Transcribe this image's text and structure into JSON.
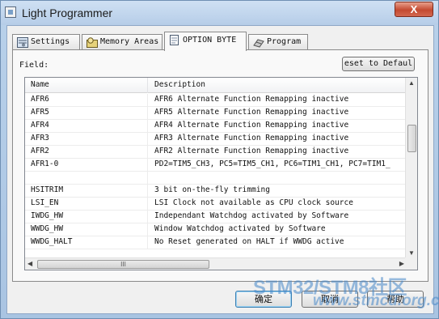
{
  "window": {
    "title": "Light Programmer",
    "close_label": "X"
  },
  "tabs": [
    {
      "label": "Settings",
      "icon": "settings-icon"
    },
    {
      "label": "Memory Areas",
      "icon": "memory-areas-icon"
    },
    {
      "label": "OPTION BYTE",
      "icon": "option-byte-icon",
      "active": true
    },
    {
      "label": "Program",
      "icon": "program-icon"
    }
  ],
  "panel": {
    "field_label": "Field:",
    "reset_button": "eset to Defaul"
  },
  "table": {
    "columns": [
      "Name",
      "Description"
    ],
    "rows": [
      {
        "name": "AFR6",
        "description": "AFR6 Alternate Function Remapping inactive"
      },
      {
        "name": "AFR5",
        "description": "AFR5 Alternate Function Remapping inactive"
      },
      {
        "name": "AFR4",
        "description": "AFR4 Alternate Function Remapping inactive"
      },
      {
        "name": "AFR3",
        "description": "AFR3 Alternate Function Remapping inactive"
      },
      {
        "name": "AFR2",
        "description": "AFR2 Alternate Function Remapping inactive"
      },
      {
        "name": "AFR1-0",
        "description": "PD2=TIM5_CH3, PC5=TIM5_CH1, PC6=TIM1_CH1, PC7=TIM1_"
      },
      {
        "name": "",
        "description": ""
      },
      {
        "name": "HSITRIM",
        "description": "3 bit on-the-fly trimming"
      },
      {
        "name": "LSI_EN",
        "description": "LSI Clock not available as CPU clock source"
      },
      {
        "name": "IWDG_HW",
        "description": "Independant Watchdog activated by Software"
      },
      {
        "name": "WWDG_HW",
        "description": "Window Watchdog activated by Software"
      },
      {
        "name": "WWDG_HALT",
        "description": "No Reset generated on HALT if WWDG active"
      }
    ],
    "hscroll_grip": "III"
  },
  "buttons": {
    "ok": "确定",
    "cancel": "取消",
    "help": "帮助"
  },
  "watermark": {
    "line1": "STM32/STM8社区",
    "line2": "www.stmcu.org.cn"
  }
}
